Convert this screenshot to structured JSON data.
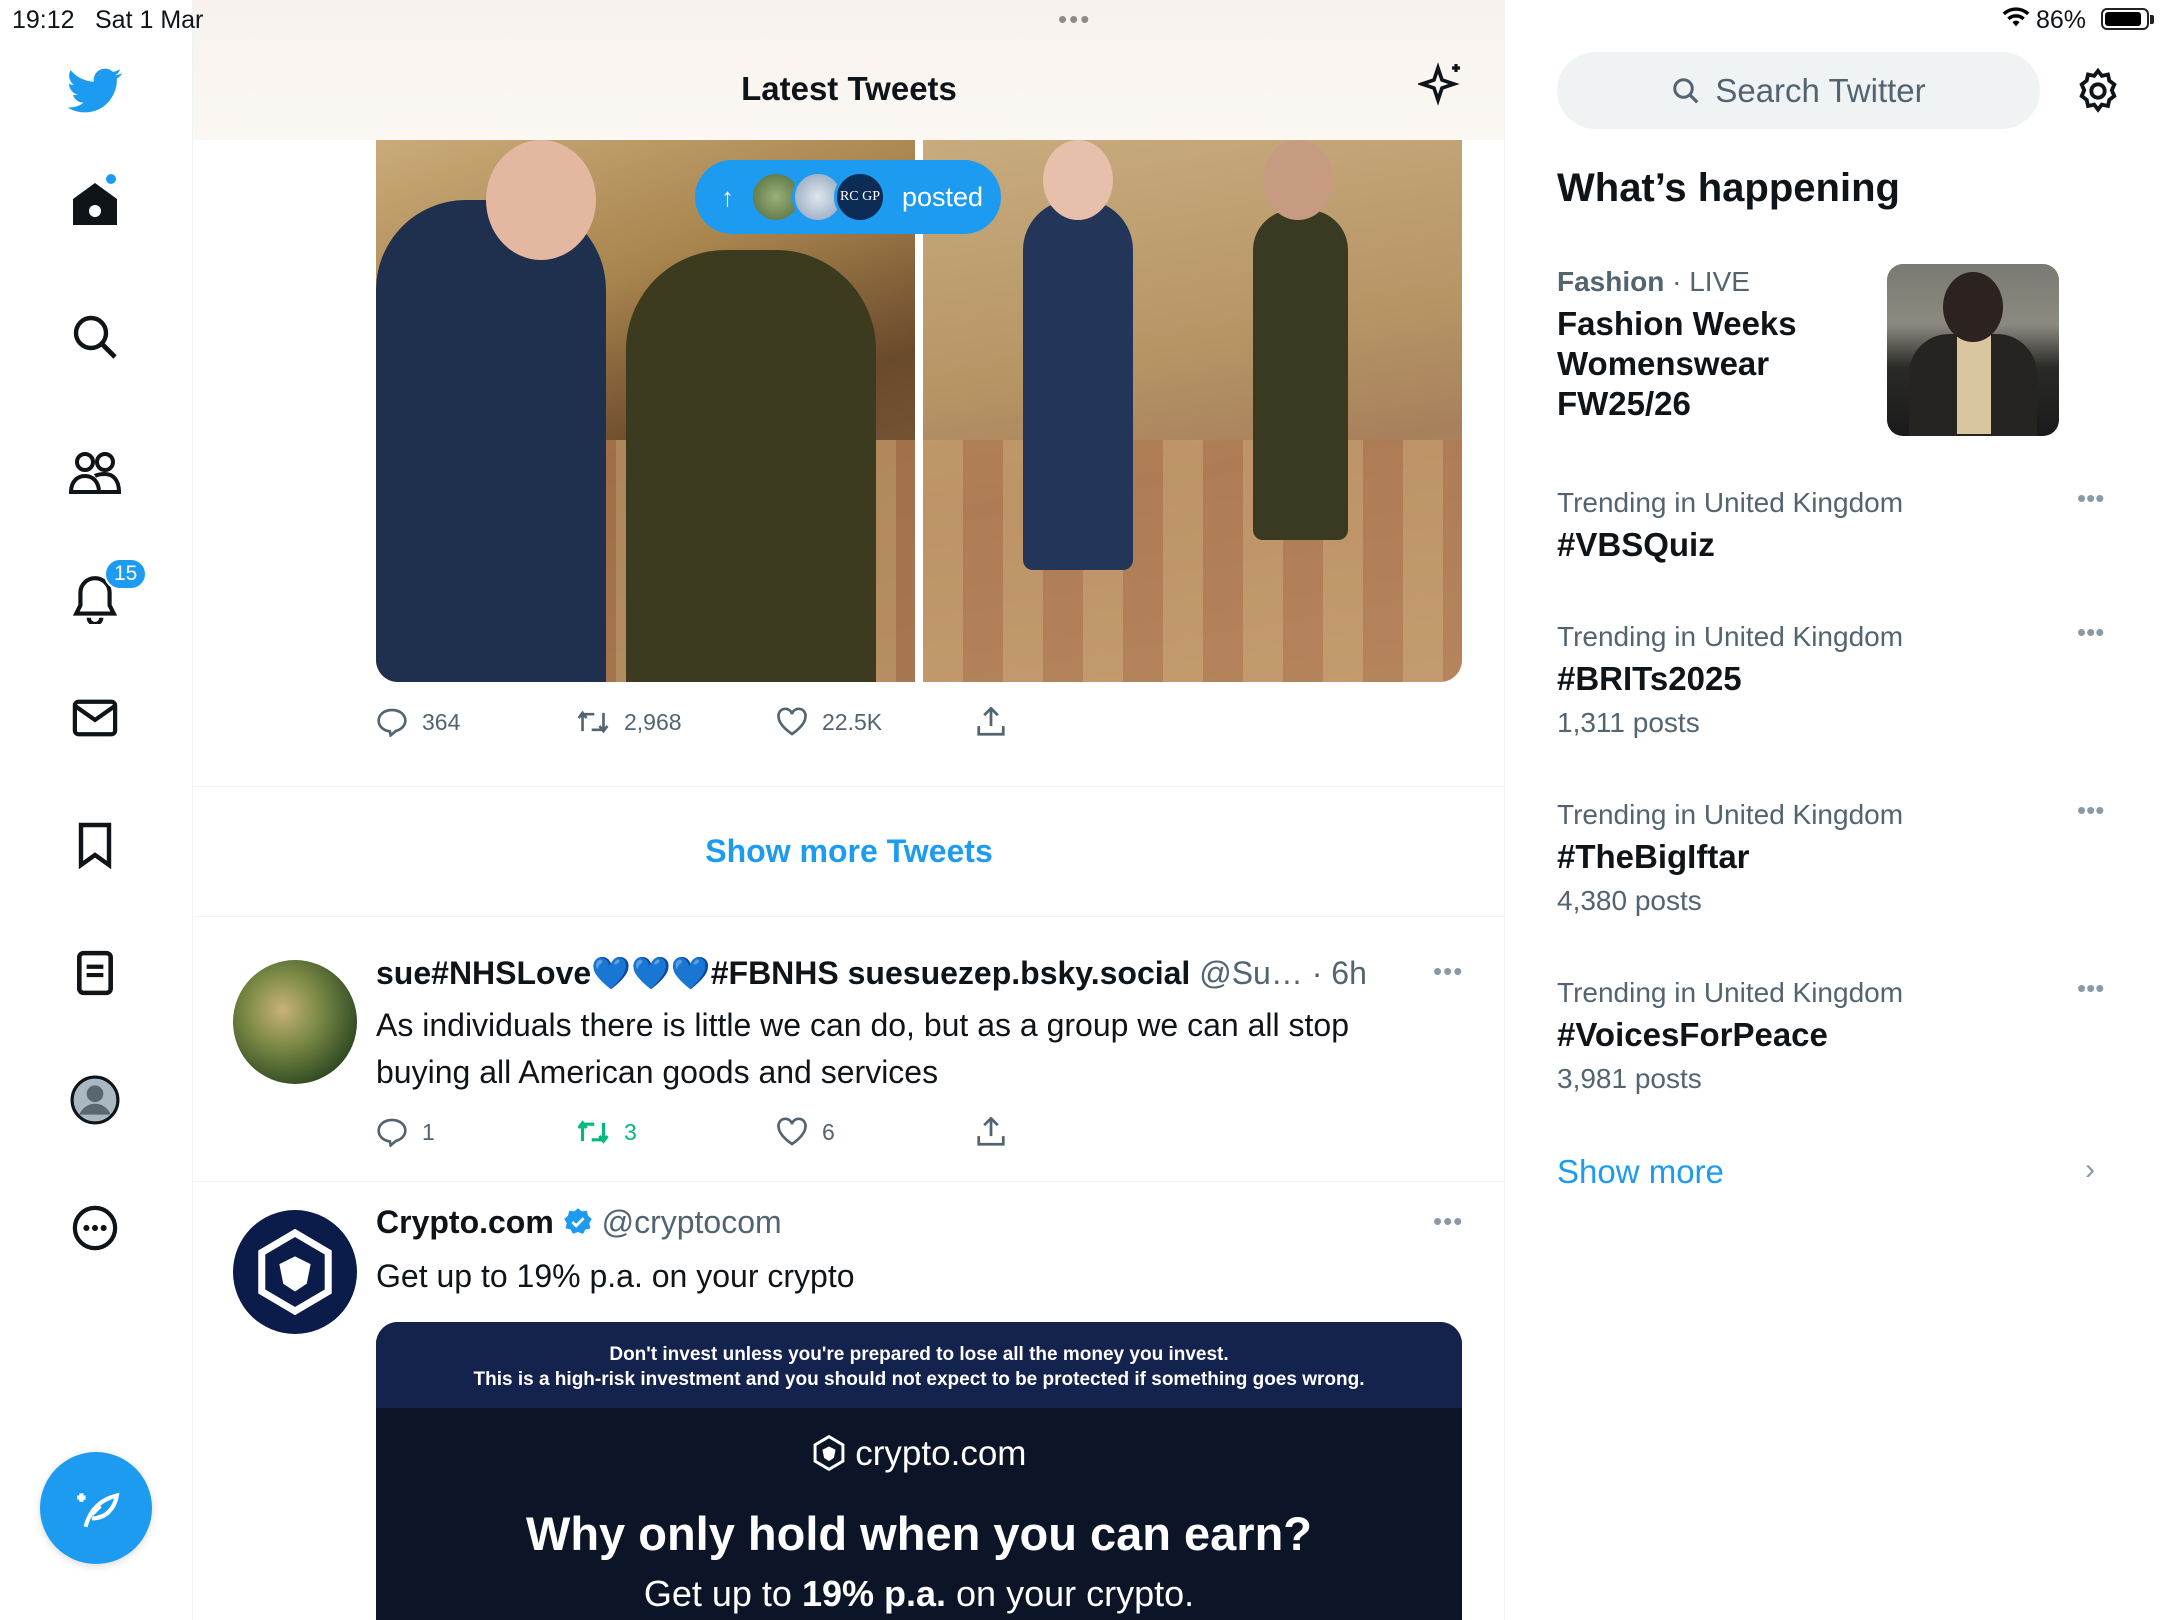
{
  "status": {
    "time": "19:12",
    "date": "Sat 1 Mar",
    "battery": "86%"
  },
  "nav": {
    "notif_badge": "15"
  },
  "header": {
    "title": "Latest Tweets"
  },
  "posted_pill": {
    "label": "posted",
    "avatar3_text": "RC GP"
  },
  "tweet1_actions": {
    "replies": "364",
    "retweets": "2,968",
    "likes": "22.5K"
  },
  "show_more_tweets": "Show more Tweets",
  "tweet2": {
    "display_name": "sue#NHSLove💙💙💙#FBNHS suesuezep.bsky.social",
    "handle": "@Su…",
    "time": "· 6h",
    "text": "As individuals there is little we can do, but as a group we can all stop buying all American goods and services",
    "replies": "1",
    "retweets": "3",
    "likes": "6"
  },
  "tweet3": {
    "display_name": "Crypto.com",
    "handle": "@cryptocom",
    "text": "Get up to 19% p.a. on your crypto",
    "ad_warning_1": "Don't invest unless you're prepared to lose all the money you invest.",
    "ad_warning_2": "This is a high-risk investment and you should not expect to be protected if something goes wrong.",
    "ad_logo": "crypto.com",
    "ad_headline": "Why only hold when you can earn?",
    "ad_sub_pre": "Get up to ",
    "ad_sub_bold": "19% p.a.",
    "ad_sub_post": " on your crypto."
  },
  "sidebar": {
    "search_placeholder": "Search Twitter",
    "heading": "What’s happening",
    "fashion": {
      "category": "Fashion",
      "live": "· LIVE",
      "title": "Fashion Weeks Womenswear FW25/26"
    },
    "trends": [
      {
        "category": "Trending in United Kingdom",
        "name": "#VBSQuiz",
        "count": ""
      },
      {
        "category": "Trending in United Kingdom",
        "name": "#BRITs2025",
        "count": "1,311 posts"
      },
      {
        "category": "Trending in United Kingdom",
        "name": "#TheBigIftar",
        "count": "4,380 posts"
      },
      {
        "category": "Trending in United Kingdom",
        "name": "#VoicesForPeace",
        "count": "3,981 posts"
      }
    ],
    "show_more": "Show more"
  },
  "colors": {
    "accent": "#1d9bf0",
    "retweet_active": "#00ba7c"
  }
}
